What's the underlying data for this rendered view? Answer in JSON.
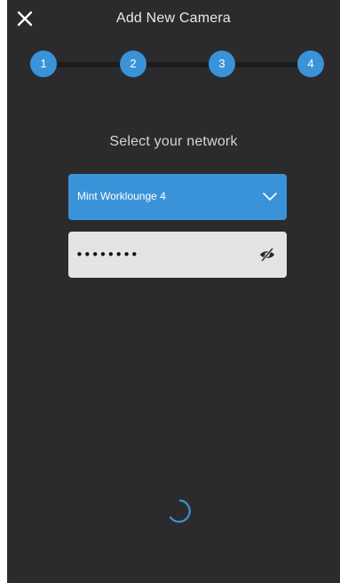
{
  "header": {
    "title": "Add New Camera",
    "close_icon": "close-icon"
  },
  "stepper": {
    "steps": [
      "1",
      "2",
      "3",
      "4"
    ]
  },
  "network": {
    "prompt": "Select your network",
    "selected": "Mint Worklounge 4",
    "chevron_icon": "chevron-down-icon"
  },
  "password": {
    "value": "••••••••",
    "toggle_icon": "eye-slash-icon"
  },
  "status": {
    "spinner_icon": "loading-spinner-icon"
  },
  "colors": {
    "background": "#2b2b2d",
    "accent": "#3a93d8",
    "field_bg": "#e4e4e6",
    "track": "#1c1c1e"
  }
}
